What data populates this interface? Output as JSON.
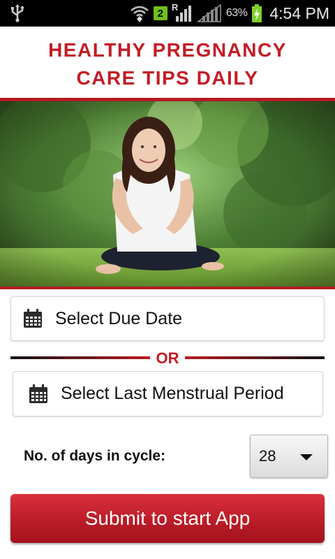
{
  "status_bar": {
    "network_badge": "2",
    "roaming_indicator": "R",
    "battery_percent": "63%",
    "time": "4:54 PM",
    "icons": [
      "usb-icon",
      "wifi-icon",
      "signal-icon",
      "battery-charging-icon"
    ]
  },
  "header": {
    "title_line1": "HEALTHY PREGNANCY",
    "title_line2": "CARE TIPS DAILY",
    "title_color": "#c41c25"
  },
  "hero": {
    "image": "pregnant-woman-sitting-on-grass"
  },
  "form": {
    "due_date_label": "Select Due Date",
    "or_label": "OR",
    "lmp_label": "Select Last Menstrual Period",
    "cycle_label": "No. of days in cycle:",
    "cycle_value": "28",
    "submit_label": "Submit to start App",
    "accent_color": "#b21b22"
  }
}
